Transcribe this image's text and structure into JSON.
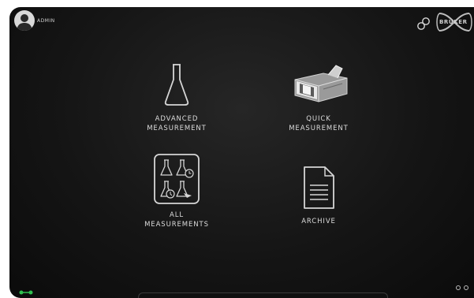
{
  "header": {
    "user_label": "ADMIN",
    "brand": "BRUKER",
    "icons": [
      "user-avatar-icon",
      "link-icon",
      "bruker-logo"
    ]
  },
  "tiles": [
    {
      "id": "advanced",
      "label_line1": "ADVANCED",
      "label_line2": "MEASUREMENT",
      "icon": "flask-icon"
    },
    {
      "id": "quick",
      "label_line1": "QUICK",
      "label_line2": "MEASUREMENT",
      "icon": "spectrometer-icon"
    },
    {
      "id": "all",
      "label_line1": "ALL",
      "label_line2": "MEASUREMENTS",
      "icon": "measurements-grid-icon"
    },
    {
      "id": "archive",
      "label_line1": "ARCHIVE",
      "icon": "document-icon"
    }
  ],
  "footer": {
    "status_icon": "connection-status-icon",
    "pager_dots": 2
  },
  "colors": {
    "background": "#151515",
    "text": "#dcdcdc",
    "status_green": "#2fbf4f",
    "device_frame": "#ffffff"
  }
}
